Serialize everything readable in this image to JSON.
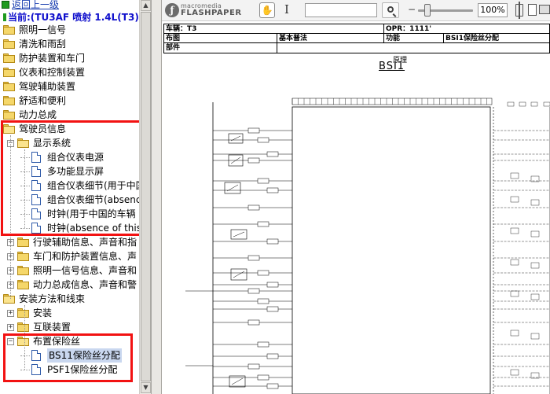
{
  "tree": {
    "back_link": "返回上一级",
    "current_title": "当前:(TU3AF 喷射 1.4L(T3)",
    "items": [
      {
        "label": "照明一信号",
        "level": 0,
        "type": "folder"
      },
      {
        "label": "清洗和雨刮",
        "level": 0,
        "type": "folder"
      },
      {
        "label": "防护装置和车门",
        "level": 0,
        "type": "folder"
      },
      {
        "label": "仪表和控制装置",
        "level": 0,
        "type": "folder"
      },
      {
        "label": "驾驶辅助装置",
        "level": 0,
        "type": "folder"
      },
      {
        "label": "舒适和便利",
        "level": 0,
        "type": "folder"
      },
      {
        "label": "动力总成",
        "level": 0,
        "type": "folder"
      },
      {
        "label": "驾驶员信息",
        "level": 0,
        "type": "folder-open"
      },
      {
        "label": "显示系统",
        "level": 1,
        "type": "folder-open"
      },
      {
        "label": "组合仪表电源",
        "level": 2,
        "type": "doc"
      },
      {
        "label": "多功能显示屏",
        "level": 2,
        "type": "doc"
      },
      {
        "label": "组合仪表细节(用于中国",
        "level": 2,
        "type": "doc"
      },
      {
        "label": "组合仪表细节(absence",
        "level": 2,
        "type": "doc"
      },
      {
        "label": "时钟(用于中国的车辆 ≡",
        "level": 2,
        "type": "doc"
      },
      {
        "label": "时钟(absence of this",
        "level": 2,
        "type": "doc"
      },
      {
        "label": "行驶辅助信息、声音和指",
        "level": 1,
        "type": "folder"
      },
      {
        "label": "车门和防护装置信息、声",
        "level": 1,
        "type": "folder"
      },
      {
        "label": "照明一信号信息、声音和",
        "level": 1,
        "type": "folder"
      },
      {
        "label": "动力总成信息、声音和警",
        "level": 1,
        "type": "folder"
      },
      {
        "label": "安装方法和线束",
        "level": 0,
        "type": "folder-open"
      },
      {
        "label": "安装",
        "level": 1,
        "type": "folder"
      },
      {
        "label": "互联装置",
        "level": 1,
        "type": "folder"
      },
      {
        "label": "布置保险丝",
        "level": 1,
        "type": "folder-open"
      },
      {
        "label": "BS11保险丝分配",
        "level": 2,
        "type": "doc",
        "selected": true
      },
      {
        "label": "PSF1保险丝分配",
        "level": 2,
        "type": "doc"
      }
    ]
  },
  "viewer": {
    "logo_top": "macromedia",
    "logo_bottom": "FLASHPAPER",
    "search_value": "",
    "zoom_level": "100%",
    "icons": [
      "hand-icon",
      "text-cursor-icon",
      "search-icon",
      "zoom-minus-icon",
      "zoom-plus-icon",
      "fit-width-icon",
      "page-icon",
      "print-icon"
    ]
  },
  "document": {
    "vehicle_label": "车辆：T3",
    "opr_label": "OPR：1111'",
    "layout_label": "布图",
    "basic_label": "基本普法",
    "function_label": "功能",
    "function_value": "BSI1保险丝分配",
    "part_label": "部件",
    "diagram_heading": "原理",
    "diagram_name": "BSI1"
  },
  "colors": {
    "highlight": "#f21212",
    "selection": "#c9d7ef",
    "title_blue": "#1010cc"
  }
}
